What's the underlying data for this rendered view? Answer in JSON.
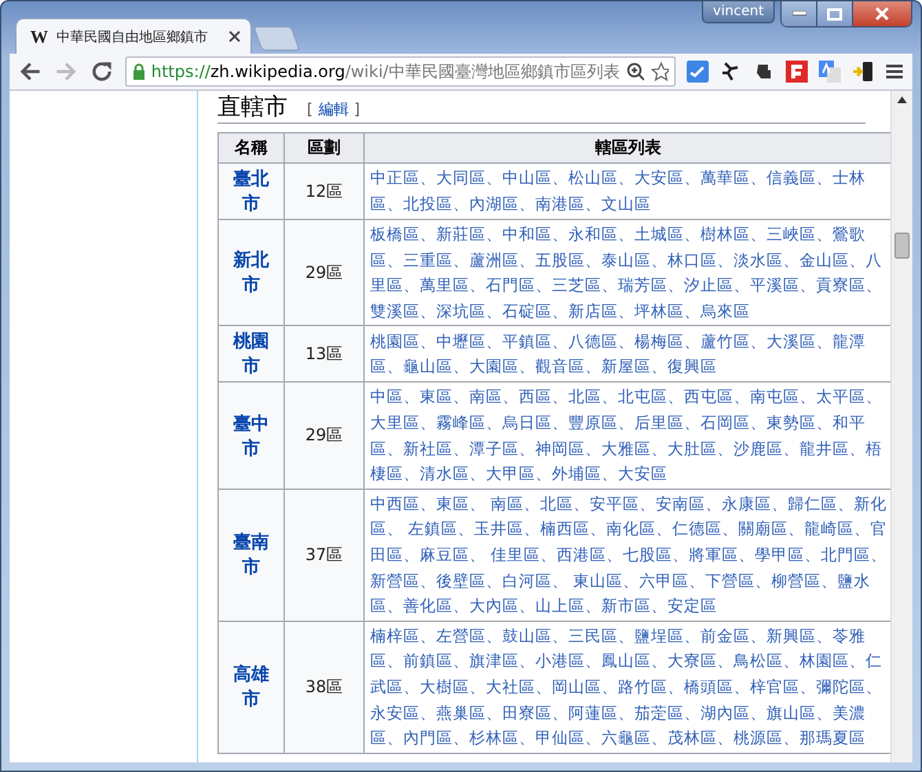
{
  "window": {
    "user": "vincent"
  },
  "tabs": [
    {
      "favicon": "W",
      "label": "中華民國自由地區鄉鎮市",
      "selected": true
    }
  ],
  "toolbar": {
    "forward_disabled": true,
    "url": {
      "scheme": "https://",
      "host": "zh.wikipedia.org",
      "path": "/wiki/中華民國臺灣地區鄉鎮市區列表"
    }
  },
  "section": {
    "heading": "直轄市",
    "edit_prefix": "[",
    "edit_link": "編輯",
    "edit_suffix": "]"
  },
  "table": {
    "columns": [
      "名稱",
      "區劃",
      "轄區列表"
    ],
    "rows": [
      {
        "name": "臺北市",
        "count": "12區",
        "districts": "中正區、大同區、中山區、松山區、大安區、萬華區、信義區、士林區、北投區、內湖區、南港區、文山區"
      },
      {
        "name": "新北市",
        "count": "29區",
        "districts": "板橋區、新莊區、中和區、永和區、土城區、樹林區、三峽區、鶯歌區、三重區、蘆洲區、五股區、泰山區、林口區、淡水區、金山區、八里區、萬里區、石門區、三芝區、瑞芳區、汐止區、平溪區、貢寮區、雙溪區、深坑區、石碇區、新店區、坪林區、烏來區"
      },
      {
        "name": "桃園市",
        "count": "13區",
        "districts": "桃園區、中壢區、平鎮區、八德區、楊梅區、蘆竹區、大溪區、龍潭區、龜山區、大園區、觀音區、新屋區、復興區"
      },
      {
        "name": "臺中市",
        "count": "29區",
        "districts": "中區、東區、南區、西區、北區、北屯區、西屯區、南屯區、太平區、大里區、霧峰區、烏日區、豐原區、后里區、石岡區、東勢區、和平區、新社區、潭子區、神岡區、大雅區、大肚區、沙鹿區、龍井區、梧棲區、清水區、大甲區、外埔區、大安區"
      },
      {
        "name": "臺南市",
        "count": "37區",
        "districts": "中西區、東區、 南區、北區、安平區、安南區、永康區、歸仁區、新化區、 左鎮區、玉井區、楠西區、南化區、仁德區、關廟區、龍崎區、官田區、麻豆區、 佳里區、西港區、七股區、將軍區、學甲區、北門區、新營區、後壁區、白河區、 東山區、六甲區、下營區、柳營區、鹽水區、善化區、大內區、山上區、新市區、安定區"
      },
      {
        "name": "高雄市",
        "count": "38區",
        "districts": "楠梓區、左營區、鼓山區、三民區、鹽埕區、前金區、新興區、苓雅區、前鎮區、旗津區、小港區、鳳山區、大寮區、鳥松區、林園區、仁武區、大樹區、大社區、岡山區、路竹區、橋頭區、梓官區、彌陀區、永安區、燕巢區、田寮區、阿蓮區、茄萣區、湖內區、旗山區、美濃區、內門區、杉林區、甲仙區、六龜區、茂林區、桃源區、那瑪夏區"
      }
    ]
  }
}
